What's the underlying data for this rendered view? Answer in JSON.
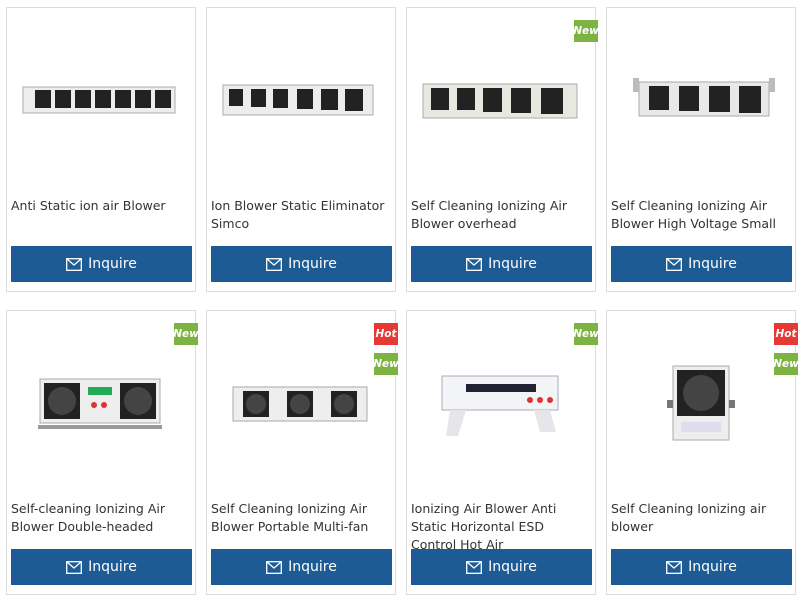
{
  "products": [
    {
      "title": "Anti Static ion air Blower",
      "button": "Inquire",
      "badges": [],
      "image": "linear-6"
    },
    {
      "title": "Ion Blower Static Eliminator Simco",
      "button": "Inquire",
      "badges": [],
      "image": "linear-6b"
    },
    {
      "title": "Self Cleaning Ionizing Air Blower overhead",
      "button": "Inquire",
      "badges": [
        "New"
      ],
      "image": "linear-5"
    },
    {
      "title": "Self Cleaning Ionizing Air Blower High Voltage Small",
      "button": "Inquire",
      "badges": [],
      "image": "linear-4-bracket"
    },
    {
      "title": "Self-cleaning Ionizing Air Blower Double-headed",
      "button": "Inquire",
      "badges": [
        "New"
      ],
      "image": "double-head"
    },
    {
      "title": "Self Cleaning Ionizing Air Blower Portable Multi-fan",
      "button": "Inquire",
      "badges": [
        "Hot",
        "New"
      ],
      "image": "triple-fan"
    },
    {
      "title": "Ionizing Air Blower Anti Static Horizontal ESD Control Hot Air",
      "button": "Inquire",
      "badges": [
        "New"
      ],
      "image": "horizontal"
    },
    {
      "title": "Self Cleaning Ionizing air blower",
      "button": "Inquire",
      "badges": [
        "Hot",
        "New"
      ],
      "image": "single-fan"
    }
  ],
  "colors": {
    "button": "#1d5b95",
    "new_badge": "#7cb342",
    "hot_badge": "#e53935"
  }
}
